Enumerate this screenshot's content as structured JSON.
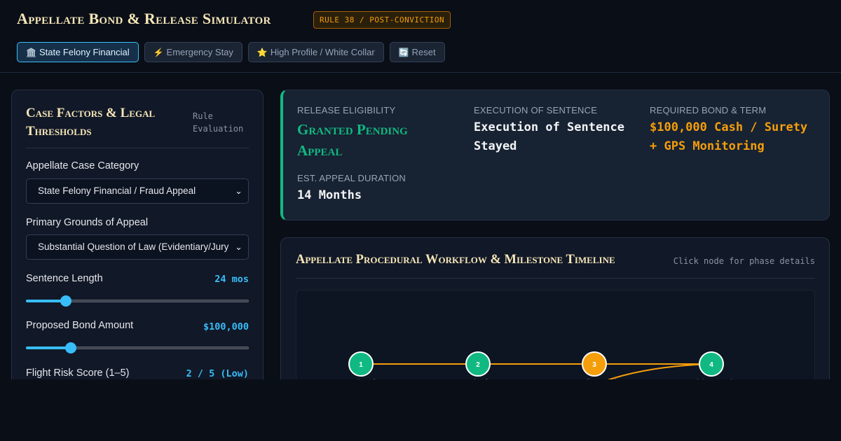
{
  "header": {
    "title": "Appellate Bond & Release Simulator",
    "badge": "RULE 38 / POST-CONVICTION",
    "presets": [
      {
        "icon": "🏛️",
        "icon_name": "courthouse-icon",
        "label": "State Felony Financial",
        "active": true
      },
      {
        "icon": "⚡",
        "icon_name": "lightning-icon",
        "label": "Emergency Stay",
        "active": false
      },
      {
        "icon": "⭐",
        "icon_name": "star-icon",
        "label": "High Profile / White Collar",
        "active": false
      },
      {
        "icon": "🔄",
        "icon_name": "reset-icon",
        "label": "Reset",
        "active": false
      }
    ]
  },
  "left_panel": {
    "title": "Case Factors & Legal Thresholds",
    "subtitle": "Rule Evaluation",
    "case_category": {
      "label": "Appellate Case Category",
      "value": "State Felony Financial / Fraud Appeal"
    },
    "grounds": {
      "label": "Primary Grounds of Appeal",
      "value": "Substantial Question of Law (Evidentiary/Jury"
    },
    "sentence": {
      "label": "Sentence Length",
      "display": "24 mos",
      "fraction": 0.18
    },
    "bond": {
      "label": "Proposed Bond Amount",
      "display": "$100,000",
      "fraction": 0.2
    },
    "flight_risk": {
      "label": "Flight Risk Score (1–5)",
      "display": "2 / 5 (Low)"
    }
  },
  "result": {
    "eligibility": {
      "label": "RELEASE ELIGIBILITY",
      "value": "Granted Pending Appeal"
    },
    "execution": {
      "label": "EXECUTION OF SENTENCE",
      "value": "Execution of Sentence Stayed"
    },
    "bond_term": {
      "label": "REQUIRED BOND & TERM",
      "value": "$100,000 Cash / Surety + GPS Monitoring"
    },
    "duration": {
      "label": "EST. APPEAL DURATION",
      "value": "14 Months"
    }
  },
  "workflow": {
    "title": "Appellate Procedural Workflow & Milestone Timeline",
    "hint": "Click node for phase details",
    "nodes": [
      {
        "num": "1",
        "status": "complete",
        "label": "Notice of"
      },
      {
        "num": "2",
        "status": "complete",
        "label": "Motion for"
      },
      {
        "num": "3",
        "status": "active",
        "label": "Appellate Track"
      },
      {
        "num": "4",
        "status": "complete",
        "label": "Trial Remand"
      }
    ]
  },
  "colors": {
    "accent": "#38bdf8",
    "success": "#10b981",
    "warning": "#f59e0b",
    "title_gold": "#f5e6b8"
  }
}
